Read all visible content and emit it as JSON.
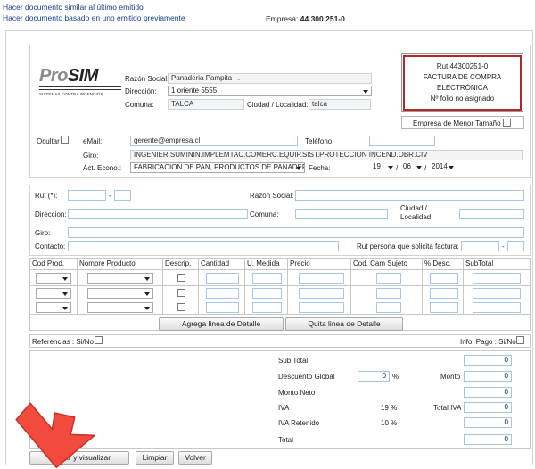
{
  "top_links": {
    "similar": "Hacer documento similar al último emitido",
    "based": "Hacer documento basado en uno emitido previamente"
  },
  "empresa": {
    "label": "Empresa:",
    "value": "44.300.251-0"
  },
  "logo": {
    "pro": "Pro",
    "sim": "SIM",
    "tagline": "SISTEMAS CONTRA INCENDIOS"
  },
  "emisor": {
    "razon_social_label": "Razón Social:",
    "razon_social": "Panaderia Pampita . .",
    "direccion_label": "Dirección:",
    "direccion": "1 oriente 5555",
    "comuna_label": "Comuna:",
    "comuna": "TALCA",
    "ciudad_label": "Ciudad / Localidad:",
    "ciudad": "talca",
    "ocultar_label": "Ocultar",
    "email_label": "eMail:",
    "email": "gerente@empresa.cl",
    "telefono_label": "Teléfono",
    "telefono": "",
    "giro_label": "Giro:",
    "giro": "INGENIER.SUMININ.IMPLEMTAC.COMERC.EQUIP.SIST.PROTECCION INCEND.OBR.CIV",
    "act_label": "Act. Econo.:",
    "act": "FABRICACION DE PAN, PRODUCTOS DE PANADERIA",
    "fecha_label": "Fecha:",
    "dia": "19",
    "mes": "06",
    "anio": "2014"
  },
  "doc_box": {
    "rut": "Rut 44300251-0",
    "line1": "FACTURA DE COMPRA",
    "line2": "ELECTRÓNICA",
    "folio": "Nº folio no asignado"
  },
  "empresa_menor": "Empresa de Menor Tamaño",
  "receptor": {
    "rut_label": "Rut (*):",
    "dash": "-",
    "razon_label": "Razón Social:",
    "direccion_label": "Direccion:",
    "comuna_label": "Comuna:",
    "ciudad_label1": "Ciudad /",
    "ciudad_label2": "Localidad:",
    "giro_label": "Giro:",
    "contacto_label": "Contacto:",
    "rut_solicita_label": "Rut persona que solicita factura:"
  },
  "detail": {
    "headers": [
      "Cod Prod.",
      "Nombre Producto",
      "Descrip.",
      "Cantidad",
      "U. Medida",
      "Precio",
      "Cod. Cam Sujeto",
      "% Desc.",
      "SubTotal"
    ],
    "add_button": "Agrega linea de Detalle",
    "remove_button": "Quita linea de Detalle"
  },
  "referencias": "Referencias : Si/No",
  "info_pago": "Info. Pago : Si/No",
  "totals": {
    "sub_total_label": "Sub Total",
    "sub_total": "0",
    "descuento_label": "Descuento Global",
    "descuento": "0",
    "pct": "%",
    "monto_label": "Monto",
    "monto": "0",
    "monto_neto_label": "Monto Neto",
    "monto_neto": "0",
    "iva_label": "IVA",
    "iva_rate": "19 %",
    "total_iva_label": "Total IVA",
    "total_iva": "0",
    "iva_ret_label": "IVA Retenido",
    "iva_ret_rate": "10 %",
    "iva_ret": "0",
    "total_label": "Total",
    "total": "0"
  },
  "buttons": {
    "validar": "Validar y visualizar",
    "limpiar": "Limpiar",
    "volver": "Volver"
  },
  "colors": {
    "link": "#1a3f8f",
    "arrow": "#f24a3c",
    "doc_border": "#b5262a",
    "input_border": "#a9c6e6"
  }
}
